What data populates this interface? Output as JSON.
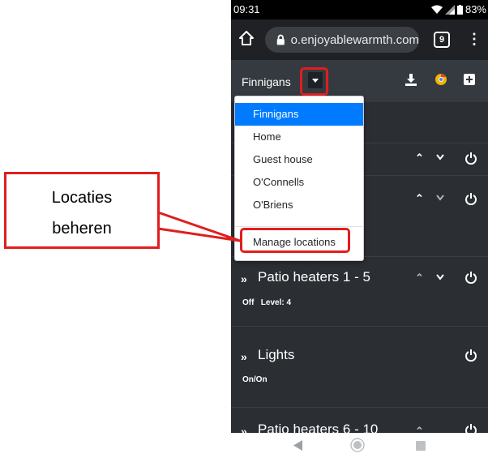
{
  "status": {
    "time": "09:31",
    "battery": "83%"
  },
  "browser": {
    "url": "o.enjoyablewarmth.com",
    "tab_count": "9"
  },
  "app": {
    "location_label": "Finnigans"
  },
  "locations": {
    "items": [
      "Finnigans",
      "Home",
      "Guest house",
      "O'Connells",
      "O'Briens"
    ],
    "manage_label": "Manage locations"
  },
  "devices": [
    {
      "title": "Patio heaters 1 - 5",
      "status": "Off   Level: 4"
    },
    {
      "title": "Lights",
      "status": "On/On"
    },
    {
      "title": "Patio heaters 6 - 10"
    }
  ],
  "callout": {
    "line1": "Locaties",
    "line2": "beheren"
  },
  "colors": {
    "highlight": "#e01e1e",
    "active_item": "#007bff",
    "app_bg": "#2b2e33"
  },
  "icons": [
    "home-icon",
    "lock-icon",
    "tabs-icon",
    "more-vert-icon",
    "download-icon",
    "chrome-icon",
    "add-icon",
    "power-icon",
    "chevron-up-icon",
    "chevron-down-icon",
    "double-chevron-down-icon",
    "back-icon",
    "home-nav-icon",
    "recents-icon"
  ]
}
